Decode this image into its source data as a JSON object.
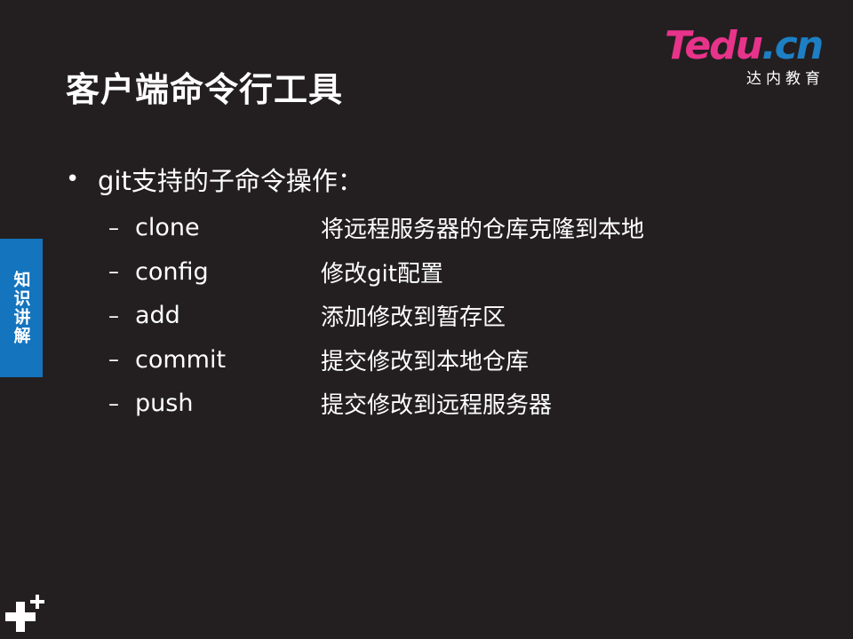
{
  "slide": {
    "title": "客户端命令行工具",
    "logo": {
      "brand": "Tedu",
      "tld": ".cn",
      "subtitle": "达内教育"
    },
    "side_tab": "知识讲解",
    "bullet": {
      "marker": "•",
      "text": "git支持的子命令操作："
    },
    "dash": "–",
    "items": [
      {
        "command": "clone",
        "description": "将远程服务器的仓库克隆到本地"
      },
      {
        "command": "config",
        "description": "修改git配置"
      },
      {
        "command": "add",
        "description": "添加修改到暂存区"
      },
      {
        "command": "commit",
        "description": "提交修改到本地仓库"
      },
      {
        "command": "push",
        "description": "提交修改到远程服务器"
      }
    ],
    "colors": {
      "background": "#231f20",
      "side_tab": "#1474be",
      "logo_pink": "#e8338b",
      "logo_blue": "#1d7fc4"
    },
    "icons": [
      "plus-icon"
    ]
  }
}
